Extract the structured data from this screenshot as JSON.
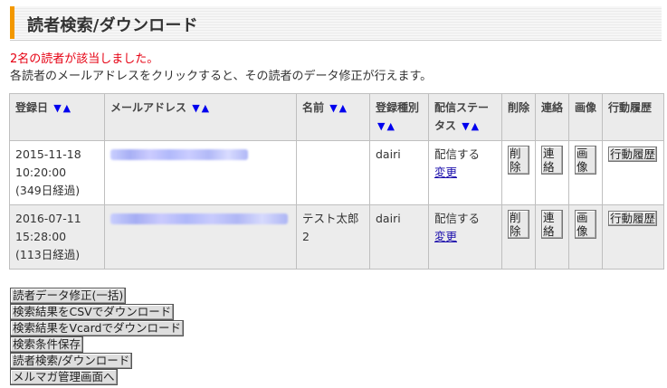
{
  "header": {
    "title": "読者検索/ダウンロード"
  },
  "result_count": "2名の読者が該当しました。",
  "instructions": "各読者のメールアドレスをクリックすると、その読者のデータ修正が行えます。",
  "table": {
    "columns": {
      "registered": "登録日",
      "email": "メールアドレス",
      "name": "名前",
      "reg_type": "登録種別",
      "status": "配信ステータス",
      "delete": "削除",
      "contact": "連絡",
      "image": "画像",
      "history": "行動履歴"
    },
    "sort_down": "▼",
    "sort_up": "▲",
    "rows": [
      {
        "date": "2015-11-18",
        "time": "10:20:00",
        "elapsed": "(349日経過)",
        "name": "",
        "reg_type": "dairi",
        "status": "配信する",
        "change_link": "変更",
        "delete_label": "削除",
        "contact_label": "連絡",
        "image_label": "画像",
        "history_label": "行動履歴"
      },
      {
        "date": "2016-07-11",
        "time": "15:28:00",
        "elapsed": "(113日経過)",
        "name": "テスト太郎2",
        "reg_type": "dairi",
        "status": "配信する",
        "change_link": "変更",
        "delete_label": "削除",
        "contact_label": "連絡",
        "image_label": "画像",
        "history_label": "行動履歴"
      }
    ]
  },
  "buttons": {
    "bulk_edit": "読者データ修正(一括)",
    "csv_download": "検索結果をCSVでダウンロード",
    "vcard_download": "検索結果をVcardでダウンロード",
    "save_conditions": "検索条件保存",
    "search_download": "読者検索/ダウンロード",
    "back_to_admin": "メルマガ管理画面へ"
  }
}
